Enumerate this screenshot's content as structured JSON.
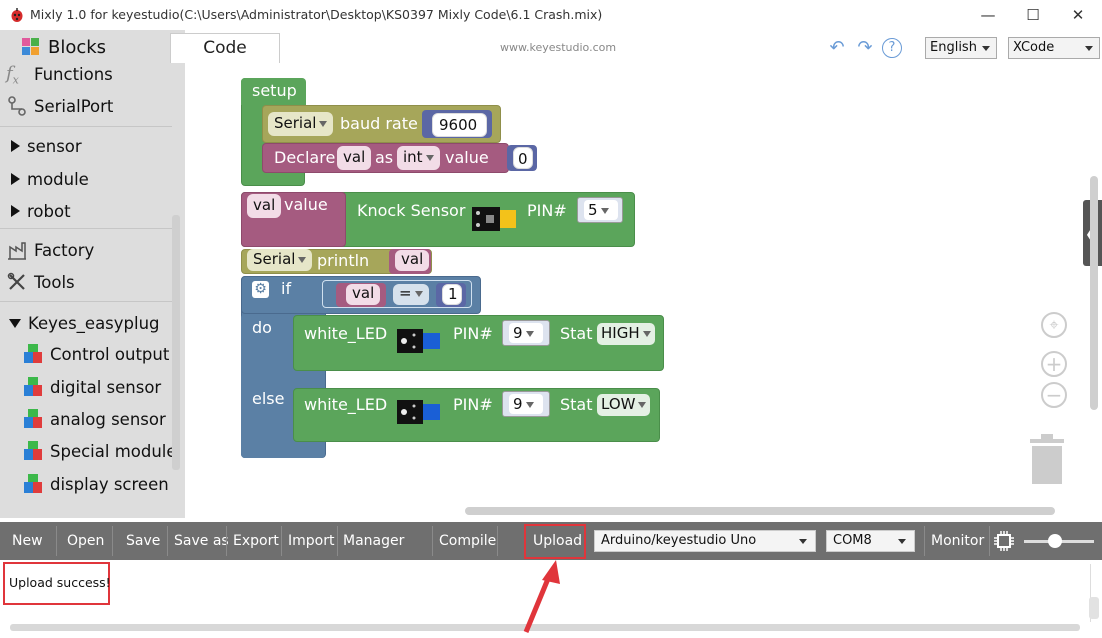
{
  "window": {
    "title": "Mixly 1.0 for keyestudio(C:\\Users\\Administrator\\Desktop\\KS0397 Mixly Code\\6.1 Crash.mix)",
    "controls": [
      "minimize",
      "maximize",
      "close"
    ]
  },
  "sidebar": {
    "blocks_label": "Blocks",
    "items": [
      {
        "label": "Functions",
        "icon": "function-icon"
      },
      {
        "label": "SerialPort",
        "icon": "serialport-icon"
      },
      {
        "label": "sensor",
        "icon": "triangle-right-icon"
      },
      {
        "label": "module",
        "icon": "triangle-right-icon"
      },
      {
        "label": "robot",
        "icon": "triangle-right-icon"
      },
      {
        "label": "Factory",
        "icon": "factory-icon"
      },
      {
        "label": "Tools",
        "icon": "tools-icon"
      },
      {
        "label": "Keyes_easyplug",
        "icon": "triangle-down-icon"
      },
      {
        "label": "Control output",
        "icon": "cube-icon"
      },
      {
        "label": "digital sensor",
        "icon": "cube-icon"
      },
      {
        "label": "analog sensor",
        "icon": "cube-icon"
      },
      {
        "label": "Special modules",
        "icon": "cube-icon"
      },
      {
        "label": "display screen",
        "icon": "cube-icon"
      }
    ]
  },
  "toolbar": {
    "code_tab": "Code",
    "url": "www.keyestudio.com",
    "language": "English",
    "code_mode": "XCode"
  },
  "blocks": {
    "setup": "setup",
    "serial": "Serial",
    "baud_rate": "baud rate",
    "baud_value": "9600",
    "declare": "Declare",
    "var": "val",
    "as": "as",
    "type": "int",
    "value": "value",
    "init": "0",
    "knock_sensor": "Knock Sensor",
    "pin_label": "PIN#",
    "knock_pin": "5",
    "println": "println",
    "if": "if",
    "do": "do",
    "else": "else",
    "op": "=",
    "compare_value": "1",
    "led": "white_LED",
    "led_pin": "9",
    "stat": "Stat",
    "high": "HIGH",
    "low": "LOW"
  },
  "bottombar": {
    "buttons": [
      "New",
      "Open",
      "Save",
      "Save as",
      "Export",
      "Import",
      "Manager",
      "Compile",
      "Upload",
      "Monitor"
    ],
    "board": "Arduino/keyestudio Uno",
    "port": "COM8"
  },
  "console": {
    "message": "Upload success!"
  },
  "colors": {
    "setup_block": "#5ba55b",
    "serial_block": "#a6a65a",
    "var_block": "#a55b80",
    "number_block": "#5b67a5",
    "logic_block": "#5b80a5",
    "highlight": "#e0353b"
  }
}
